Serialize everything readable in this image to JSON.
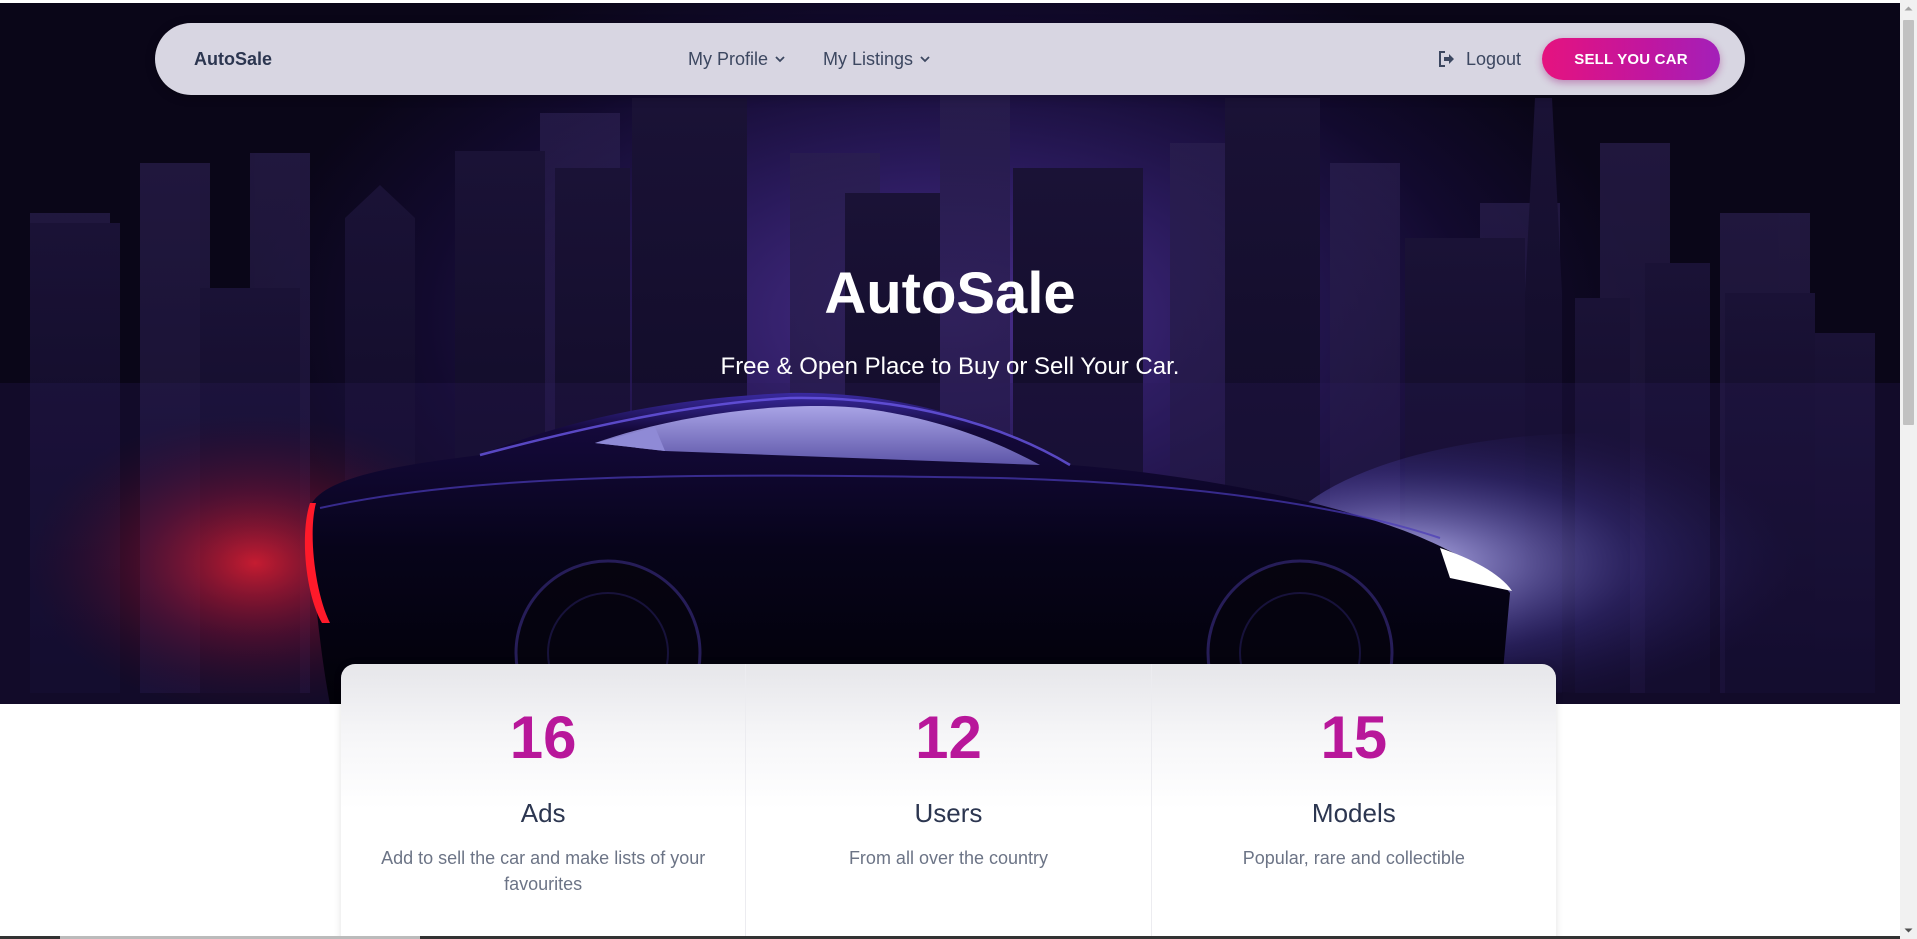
{
  "navbar": {
    "brand": "AutoSale",
    "profile_label": "My Profile",
    "listings_label": "My Listings",
    "logout_label": "Logout",
    "sell_button_label": "SELL YOU CAR"
  },
  "hero": {
    "title": "AutoSale",
    "subtitle": "Free & Open Place to Buy or Sell Your Car."
  },
  "stats": [
    {
      "number": "16",
      "title": "Ads",
      "description": "Add to sell the car and make lists of your favourites"
    },
    {
      "number": "12",
      "title": "Users",
      "description": "From all over the country"
    },
    {
      "number": "15",
      "title": "Models",
      "description": "Popular, rare and collectible"
    }
  ],
  "icons": {
    "profile_dropdown": "chevron-down-icon",
    "listings_dropdown": "chevron-down-icon",
    "logout": "sign-out-icon"
  },
  "colors": {
    "accent": "#e5137f",
    "accent_end": "#a320b9",
    "stat_number": "#b8179a",
    "navbar_bg": "#d8d6e2",
    "hero_dark": "#0a0618",
    "hero_glow": "#4a2f8c",
    "text_dark": "#2c3650"
  }
}
